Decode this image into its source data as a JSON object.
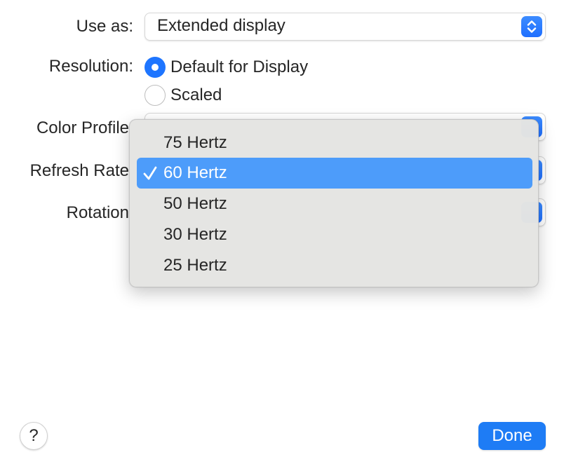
{
  "use_as": {
    "label": "Use as:",
    "value": "Extended display"
  },
  "resolution": {
    "label": "Resolution:",
    "options": [
      {
        "label": "Default for Display",
        "selected": true
      },
      {
        "label": "Scaled",
        "selected": false
      }
    ]
  },
  "color_profile": {
    "label": "Color Profile"
  },
  "refresh_rate": {
    "label": "Refresh Rate",
    "options": [
      "75 Hertz",
      "60 Hertz",
      "50 Hertz",
      "30 Hertz",
      "25 Hertz"
    ],
    "selected": "60 Hertz"
  },
  "rotation": {
    "label": "Rotation"
  },
  "footer": {
    "help_label": "?",
    "done_label": "Done"
  },
  "icons": {
    "stepper": "chevron-up-down-icon",
    "check": "checkmark-icon"
  },
  "colors": {
    "accent": "#1e75ff",
    "menu_highlight": "#4d9cfa",
    "done_button": "#1e7cf5",
    "menu_background": "#e4e4e2"
  }
}
